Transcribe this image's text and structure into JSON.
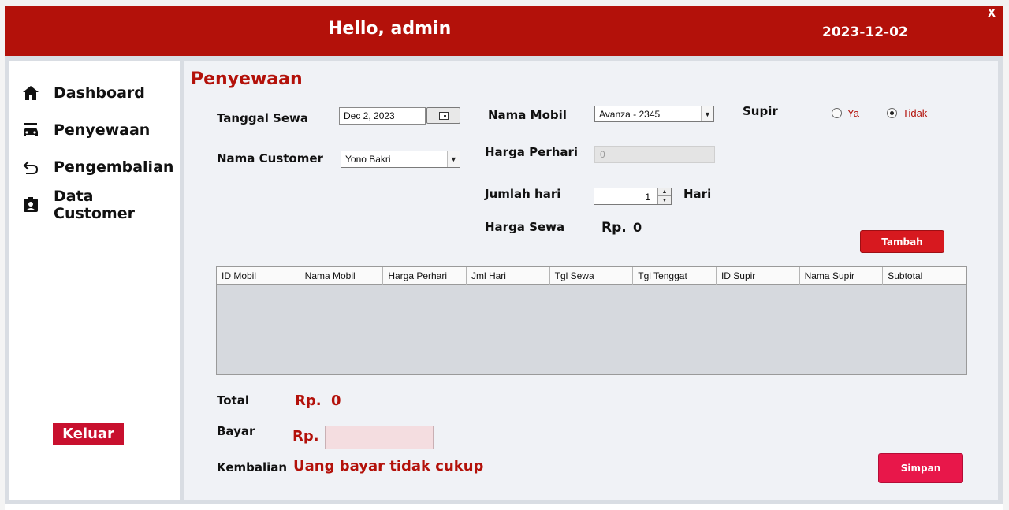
{
  "header": {
    "greeting": "Hello, admin",
    "date": "2023-12-02",
    "close_label": "X"
  },
  "sidebar": {
    "items": [
      {
        "label": "Dashboard",
        "icon": "home-icon"
      },
      {
        "label": "Penyewaan",
        "icon": "car-icon"
      },
      {
        "label": "Pengembalian",
        "icon": "return-arrow-icon"
      },
      {
        "label": "Data Customer",
        "icon": "id-badge-icon"
      }
    ],
    "logout_label": "Keluar"
  },
  "form": {
    "title": "Penyewaan",
    "tanggal_sewa_label": "Tanggal Sewa",
    "tanggal_sewa_value": "Dec 2, 2023",
    "nama_customer_label": "Nama Customer",
    "nama_customer_value": "Yono Bakri",
    "nama_mobil_label": "Nama Mobil",
    "nama_mobil_value": "Avanza - 2345",
    "harga_perhari_label": "Harga Perhari",
    "harga_perhari_value": "0",
    "jumlah_hari_label": "Jumlah hari",
    "jumlah_hari_value": "1",
    "hari_label": "Hari",
    "harga_sewa_label": "Harga Sewa",
    "harga_sewa_prefix": "Rp.",
    "harga_sewa_value": "0",
    "supir_label": "Supir",
    "supir_options": [
      "Ya",
      "Tidak"
    ],
    "supir_selected": "Tidak",
    "tambah_label": "Tambah"
  },
  "table": {
    "columns": [
      "ID Mobil",
      "Nama Mobil",
      "Harga Perhari",
      "Jml Hari",
      "Tgl Sewa",
      "Tgl Tenggat",
      "ID Supir",
      "Nama Supir",
      "Subtotal"
    ],
    "rows": []
  },
  "summary": {
    "total_label": "Total",
    "total_prefix": "Rp.",
    "total_value": "0",
    "bayar_label": "Bayar",
    "bayar_prefix": "Rp.",
    "bayar_value": "",
    "kembalian_label": "Kembalian",
    "kembalian_value": "Uang bayar tidak cukup",
    "simpan_label": "Simpan"
  },
  "colors": {
    "header_red": "#b3110a",
    "accent_red": "#d7191f",
    "simpan_pink": "#e8174a"
  }
}
